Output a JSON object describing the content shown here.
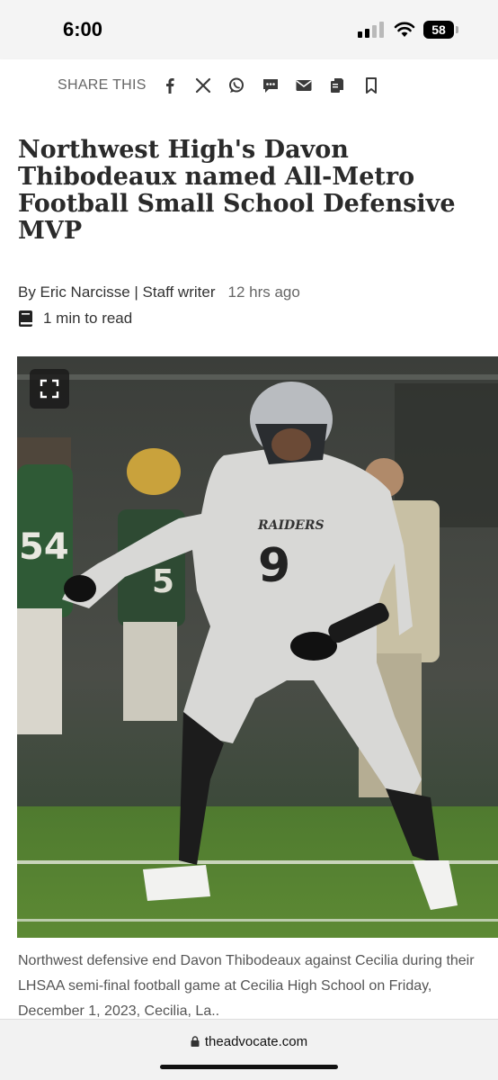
{
  "status_bar": {
    "time": "6:00",
    "battery": "58"
  },
  "share_bar": {
    "label": "SHARE THIS",
    "icons": [
      "facebook-icon",
      "x-icon",
      "whatsapp-icon",
      "sms-icon",
      "email-icon",
      "copy-link-icon",
      "bookmark-icon"
    ]
  },
  "article": {
    "headline": "Northwest High's Davon Thibodeaux named All-Metro Football Small School Defensive MVP",
    "author": "By Eric Narcisse | Staff writer",
    "time_ago": "12 hrs ago",
    "read_time": "1 min to read",
    "photo_jersey_text": "RAIDERS",
    "photo_jersey_number": "9",
    "caption": "Northwest defensive end Davon Thibodeaux against Cecilia during their LHSAA semi-final football game at Cecilia High School on Friday, December 1, 2023, Cecilia, La.."
  },
  "browser": {
    "url": "theadvocate.com"
  },
  "colors": {
    "headline": "#2a2a2a",
    "share_icons": "#3a3a3a",
    "background": "#f4f4f4"
  }
}
